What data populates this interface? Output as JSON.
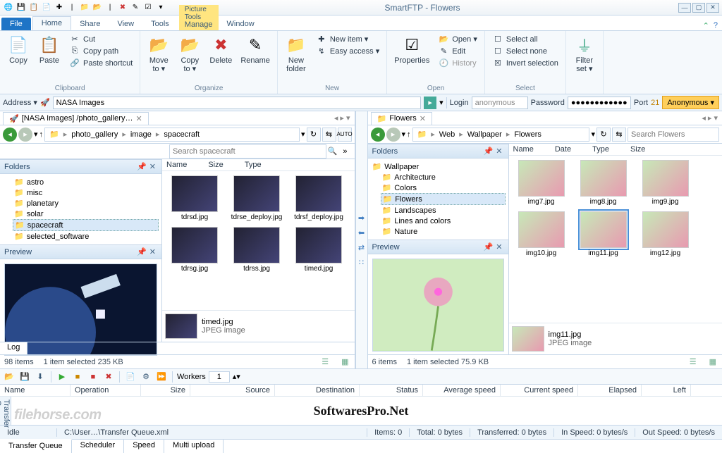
{
  "app": {
    "title": "SmartFTP - Flowers"
  },
  "tabs": {
    "file": "File",
    "home": "Home",
    "share": "Share",
    "view": "View",
    "tools": "Tools",
    "manage": "Manage",
    "window": "Window",
    "context_group": "Picture Tools"
  },
  "ribbon": {
    "clipboard": {
      "name": "Clipboard",
      "copy": "Copy",
      "paste": "Paste",
      "cut": "Cut",
      "copypath": "Copy path",
      "pasteshortcut": "Paste shortcut"
    },
    "organize": {
      "name": "Organize",
      "moveto": "Move\nto ▾",
      "copyto": "Copy\nto ▾",
      "delete": "Delete",
      "rename": "Rename"
    },
    "new": {
      "name": "New",
      "newfolder": "New\nfolder",
      "newitem": "New item ▾",
      "easyaccess": "Easy access ▾"
    },
    "open": {
      "name": "Open",
      "properties": "Properties",
      "open": "Open ▾",
      "edit": "Edit",
      "history": "History"
    },
    "select": {
      "name": "Select",
      "all": "Select all",
      "none": "Select none",
      "invert": "Invert selection"
    },
    "filter": {
      "name": "",
      "filterset": "Filter\nset ▾"
    }
  },
  "addressbar": {
    "label": "Address ▾",
    "value": "NASA Images",
    "login_lbl": "Login",
    "login_val": "anonymous",
    "pwd_lbl": "Password",
    "pwd_val": "●●●●●●●●●●●●",
    "port_lbl": "Port",
    "port_val": "21",
    "anon": "Anonymous ▾"
  },
  "left": {
    "tab": "[NASA Images] /photo_gallery…",
    "crumbs": [
      "photo_gallery",
      "image",
      "spacecraft"
    ],
    "search_ph": "Search spacecraft",
    "folders_hdr": "Folders",
    "tree": [
      "astro",
      "misc",
      "planetary",
      "solar",
      "spacecraft",
      "selected_software"
    ],
    "tree_sel": 4,
    "preview_hdr": "Preview",
    "cols": {
      "name": "Name",
      "size": "Size",
      "type": "Type"
    },
    "files": [
      "tdrsd.jpg",
      "tdrse_deploy.jpg",
      "tdrsf_deploy.jpg",
      "tdrsg.jpg",
      "tdrss.jpg",
      "timed.jpg"
    ],
    "sel_file": {
      "name": "timed.jpg",
      "type": "JPEG image"
    },
    "log_tab": "Log",
    "status": {
      "count": "98 items",
      "sel": "1 item selected  235 KB"
    }
  },
  "right": {
    "tab": "Flowers",
    "crumbs": [
      "Web",
      "Wallpaper",
      "Flowers"
    ],
    "search_ph": "Search Flowers",
    "folders_hdr": "Folders",
    "tree_parent": "Wallpaper",
    "tree": [
      "Architecture",
      "Colors",
      "Flowers",
      "Landscapes",
      "Lines and colors",
      "Nature"
    ],
    "tree_sel": 2,
    "preview_hdr": "Preview",
    "cols": {
      "name": "Name",
      "date": "Date",
      "type": "Type",
      "size": "Size"
    },
    "files": [
      "img7.jpg",
      "img8.jpg",
      "img9.jpg",
      "img10.jpg",
      "img11.jpg",
      "img12.jpg"
    ],
    "files_sel": 4,
    "sel_file": {
      "name": "img11.jpg",
      "type": "JPEG image"
    },
    "status": {
      "count": "6 items",
      "sel": "1 item selected  75.9 KB"
    }
  },
  "tq": {
    "side": "Transfer Queue",
    "workers_lbl": "Workers",
    "workers_val": "1",
    "cols": [
      "Name",
      "Operation",
      "Size",
      "Source",
      "Destination",
      "Status",
      "Average speed",
      "Current speed",
      "Elapsed",
      "Left"
    ],
    "watermark": "SoftwaresPro.Net"
  },
  "status": {
    "idle": "Idle",
    "path": "C:\\User…\\Transfer Queue.xml",
    "items": "Items: 0",
    "total": "Total: 0 bytes",
    "transferred": "Transferred: 0 bytes",
    "inspeed": "In Speed: 0 bytes/s",
    "outspeed": "Out Speed: 0 bytes/s"
  },
  "bottomtabs": [
    "Transfer Queue",
    "Scheduler",
    "Speed",
    "Multi upload"
  ],
  "filehorse": "filehorse.com"
}
